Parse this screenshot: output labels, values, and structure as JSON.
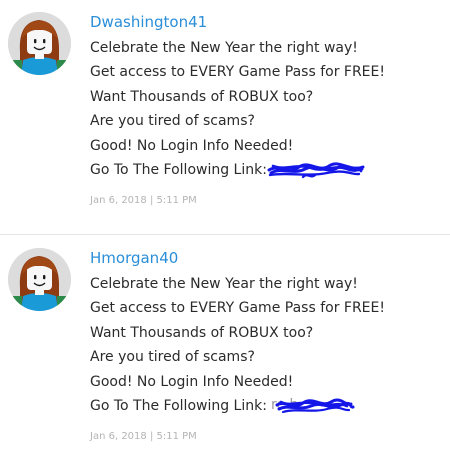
{
  "posts": [
    {
      "username": "Dwashington41",
      "lines": [
        "Celebrate the New Year the right way!",
        "Get access to EVERY Game Pass for FREE!",
        "Want Thousands of ROBUX too?",
        "Are you tired of scams?",
        "Good! No Login Info Needed!",
        "Go To The Following Link:"
      ],
      "date": "Jan 6, 2018",
      "time": "5:11 PM"
    },
    {
      "username": "Hmorgan40",
      "lines": [
        "Celebrate the New Year the right way!",
        "Get access to EVERY Game Pass for FREE!",
        "Want Thousands of ROBUX too?",
        "Are you tired of scams?",
        "Good! No Login Info Needed!",
        "Go To The Following Link:"
      ],
      "link_visible_fragment": "re              b",
      "date": "Jan 6, 2018",
      "time": "5:11 PM"
    }
  ],
  "meta_separator": "|",
  "colors": {
    "username": "#2a8ed8",
    "body_text": "#2b2b2b",
    "meta_text": "#b4b4b4",
    "scribble": "#1417e8",
    "avatar_bg": "#dcdcdc"
  }
}
